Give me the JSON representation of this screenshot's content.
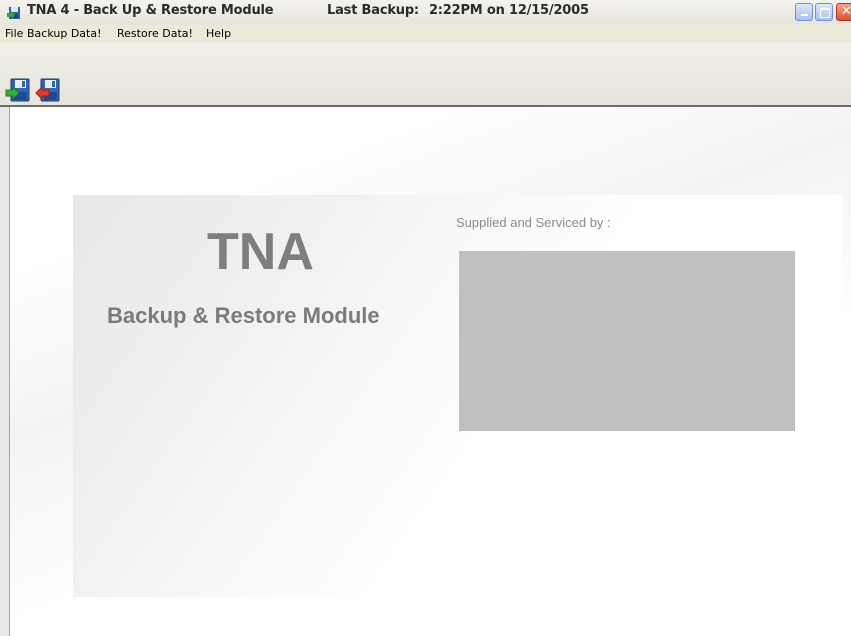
{
  "window": {
    "title": "TNA 4 - Back Up & Restore Module",
    "last_backup_label": "Last Backup:",
    "last_backup_value": "2:22PM on 12/15/2005"
  },
  "menu": {
    "file": "File",
    "backup": "Backup Data!",
    "restore": "Restore Data!",
    "help": "Help"
  },
  "toolbar": {
    "buttons": [
      {
        "name": "backup-data",
        "icon": "floppy-green-arrow-icon"
      },
      {
        "name": "restore-data",
        "icon": "floppy-red-arrow-icon"
      }
    ]
  },
  "main": {
    "title": "TNA",
    "subtitle": "Backup & Restore Module",
    "supplied_label": "Supplied and Serviced by :"
  },
  "colors": {
    "title_text": "#7e7e7e",
    "logo_placeholder": "#c0c0c0",
    "toolbar_border": "#6b6b6b"
  }
}
